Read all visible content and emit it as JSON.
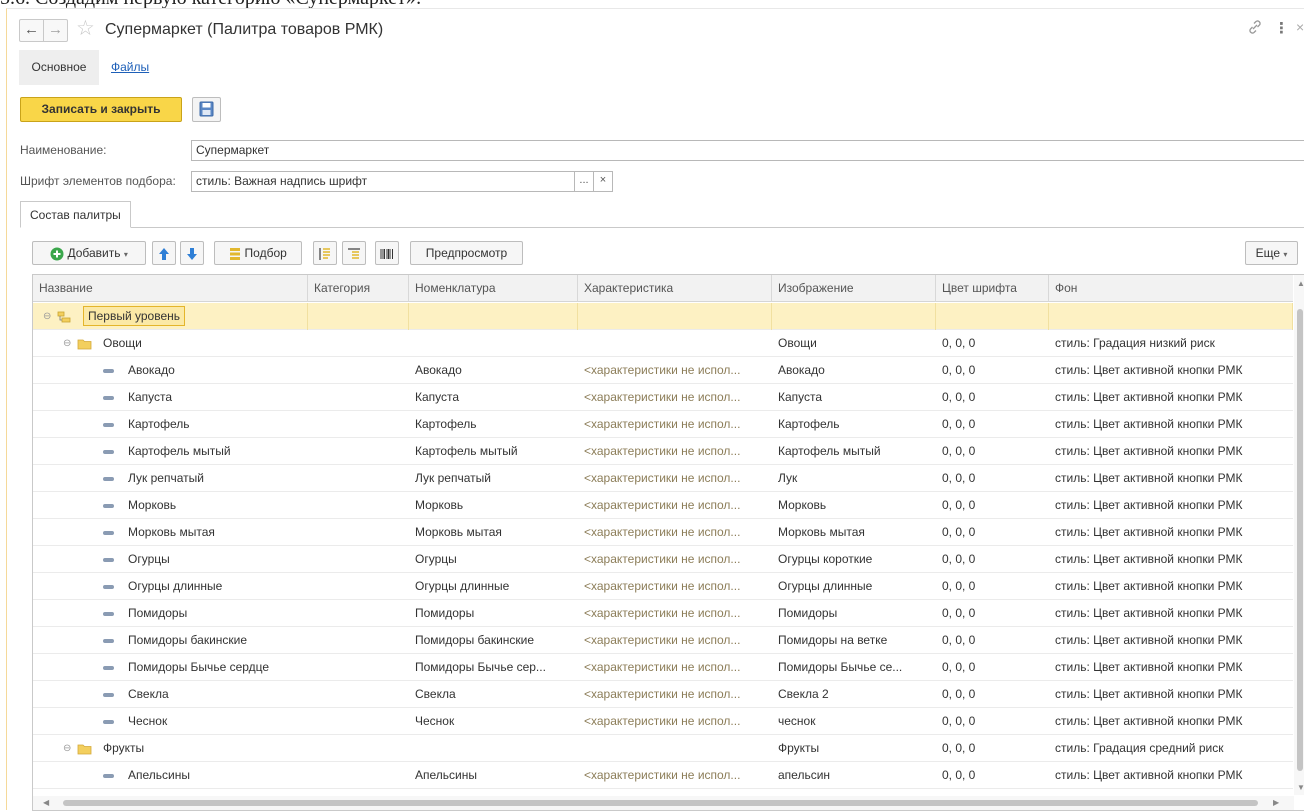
{
  "doc_caption": "5.6. Создадим первую категорию «Супермаркет»:",
  "header": {
    "title": "Супермаркет (Палитра товаров РМК)",
    "back_glyph": "←",
    "forward_glyph": "→",
    "star_glyph": "☆",
    "link_glyph": "🔗",
    "more_glyph": "⋮",
    "close_glyph": "×"
  },
  "form_tabs": {
    "main": "Основное",
    "files": "Файлы"
  },
  "toolbar": {
    "save_close": "Записать и закрыть"
  },
  "fields": {
    "name_label": "Наименование:",
    "name_value": "Супермаркет",
    "font_label": "Шрифт элементов подбора:",
    "font_value": "стиль: Важная надпись шрифт",
    "select_glyph": "...",
    "clear_glyph": "×"
  },
  "panel_tab": "Состав палитры",
  "grid_toolbar": {
    "add": "Добавить",
    "pick": "Подбор",
    "preview": "Предпросмотр",
    "more": "Еще"
  },
  "grid": {
    "columns": [
      "Название",
      "Категория",
      "Номенклатура",
      "Характеристика",
      "Изображение",
      "Цвет шрифта",
      "Фон"
    ],
    "rows": [
      {
        "level": 0,
        "type": "root",
        "name": "Первый уровень",
        "category": "",
        "nomenclature": "",
        "characteristic": "",
        "image": "",
        "font_color": "",
        "background": ""
      },
      {
        "level": 1,
        "type": "folder",
        "name": "Овощи",
        "category": "",
        "nomenclature": "",
        "characteristic": "",
        "image": "Овощи",
        "font_color": "0, 0, 0",
        "background": "стиль: Градация низкий риск"
      },
      {
        "level": 2,
        "type": "item",
        "name": "Авокадо",
        "category": "",
        "nomenclature": "Авокадо",
        "characteristic": "<характеристики не испол...",
        "image": "Авокадо",
        "font_color": "0, 0, 0",
        "background": "стиль: Цвет активной кнопки РМК"
      },
      {
        "level": 2,
        "type": "item",
        "name": "Капуста",
        "category": "",
        "nomenclature": "Капуста",
        "characteristic": "<характеристики не испол...",
        "image": "Капуста",
        "font_color": "0, 0, 0",
        "background": "стиль: Цвет активной кнопки РМК"
      },
      {
        "level": 2,
        "type": "item",
        "name": "Картофель",
        "category": "",
        "nomenclature": "Картофель",
        "characteristic": "<характеристики не испол...",
        "image": "Картофель",
        "font_color": "0, 0, 0",
        "background": "стиль: Цвет активной кнопки РМК"
      },
      {
        "level": 2,
        "type": "item",
        "name": "Картофель мытый",
        "category": "",
        "nomenclature": "Картофель мытый",
        "characteristic": "<характеристики не испол...",
        "image": "Картофель мытый",
        "font_color": "0, 0, 0",
        "background": "стиль: Цвет активной кнопки РМК"
      },
      {
        "level": 2,
        "type": "item",
        "name": "Лук репчатый",
        "category": "",
        "nomenclature": "Лук репчатый",
        "characteristic": "<характеристики не испол...",
        "image": "Лук",
        "font_color": "0, 0, 0",
        "background": "стиль: Цвет активной кнопки РМК"
      },
      {
        "level": 2,
        "type": "item",
        "name": "Морковь",
        "category": "",
        "nomenclature": "Морковь",
        "characteristic": "<характеристики не испол...",
        "image": "Морковь",
        "font_color": "0, 0, 0",
        "background": "стиль: Цвет активной кнопки РМК"
      },
      {
        "level": 2,
        "type": "item",
        "name": "Морковь мытая",
        "category": "",
        "nomenclature": "Морковь мытая",
        "characteristic": "<характеристики не испол...",
        "image": "Морковь мытая",
        "font_color": "0, 0, 0",
        "background": "стиль: Цвет активной кнопки РМК"
      },
      {
        "level": 2,
        "type": "item",
        "name": "Огурцы",
        "category": "",
        "nomenclature": "Огурцы",
        "characteristic": "<характеристики не испол...",
        "image": "Огурцы короткие",
        "font_color": "0, 0, 0",
        "background": "стиль: Цвет активной кнопки РМК"
      },
      {
        "level": 2,
        "type": "item",
        "name": "Огурцы длинные",
        "category": "",
        "nomenclature": "Огурцы длинные",
        "characteristic": "<характеристики не испол...",
        "image": "Огурцы длинные",
        "font_color": "0, 0, 0",
        "background": "стиль: Цвет активной кнопки РМК"
      },
      {
        "level": 2,
        "type": "item",
        "name": "Помидоры",
        "category": "",
        "nomenclature": "Помидоры",
        "characteristic": "<характеристики не испол...",
        "image": "Помидоры",
        "font_color": "0, 0, 0",
        "background": "стиль: Цвет активной кнопки РМК"
      },
      {
        "level": 2,
        "type": "item",
        "name": "Помидоры бакинские",
        "category": "",
        "nomenclature": "Помидоры бакинские",
        "characteristic": "<характеристики не испол...",
        "image": "Помидоры на ветке",
        "font_color": "0, 0, 0",
        "background": "стиль: Цвет активной кнопки РМК"
      },
      {
        "level": 2,
        "type": "item",
        "name": "Помидоры Бычье сердце",
        "category": "",
        "nomenclature": "Помидоры Бычье сер...",
        "characteristic": "<характеристики не испол...",
        "image": "Помидоры Бычье се...",
        "font_color": "0, 0, 0",
        "background": "стиль: Цвет активной кнопки РМК"
      },
      {
        "level": 2,
        "type": "item",
        "name": "Свекла",
        "category": "",
        "nomenclature": "Свекла",
        "characteristic": "<характеристики не испол...",
        "image": "Свекла 2",
        "font_color": "0, 0, 0",
        "background": "стиль: Цвет активной кнопки РМК"
      },
      {
        "level": 2,
        "type": "item",
        "name": "Чеснок",
        "category": "",
        "nomenclature": "Чеснок",
        "characteristic": "<характеристики не испол...",
        "image": "чеснок",
        "font_color": "0, 0, 0",
        "background": "стиль: Цвет активной кнопки РМК"
      },
      {
        "level": 1,
        "type": "folder",
        "name": "Фрукты",
        "category": "",
        "nomenclature": "",
        "characteristic": "",
        "image": "Фрукты",
        "font_color": "0, 0, 0",
        "background": "стиль: Градация средний риск"
      },
      {
        "level": 2,
        "type": "item",
        "name": "Апельсины",
        "category": "",
        "nomenclature": "Апельсины",
        "characteristic": "<характеристики не испол...",
        "image": "апельсин",
        "font_color": "0, 0, 0",
        "background": "стиль: Цвет активной кнопки РМК"
      }
    ]
  },
  "colors": {
    "accent_yellow": "#f9d648",
    "selection": "#fdf1c3",
    "link_blue": "#1d5fb8",
    "add_green": "#3aa64b",
    "arrow_blue": "#2f7fd6",
    "folder_yellow": "#f3cf5e"
  }
}
